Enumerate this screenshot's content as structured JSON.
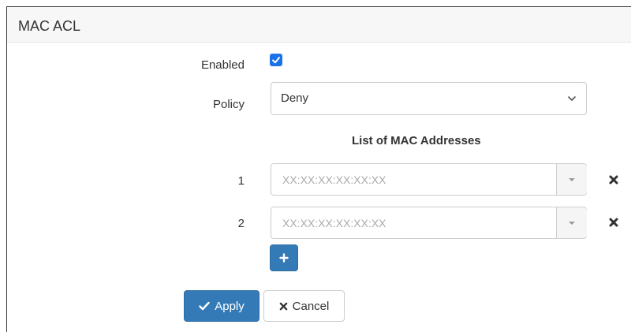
{
  "panel": {
    "title": "MAC ACL"
  },
  "enabled": {
    "label": "Enabled",
    "checked": true,
    "check_color": "#1a73e8"
  },
  "policy": {
    "label": "Policy",
    "value": "Deny"
  },
  "mac_list": {
    "title": "List of MAC Addresses",
    "rows": [
      {
        "index": "1",
        "placeholder": "XX:XX:XX:XX:XX:XX",
        "value": ""
      },
      {
        "index": "2",
        "placeholder": "XX:XX:XX:XX:XX:XX",
        "value": ""
      }
    ],
    "add_icon": "plus-icon",
    "remove_icon": "times-icon"
  },
  "actions": {
    "apply_label": "Apply",
    "apply_icon": "check-icon",
    "cancel_label": "Cancel",
    "cancel_icon": "times-icon",
    "primary_color": "#337ab7"
  }
}
